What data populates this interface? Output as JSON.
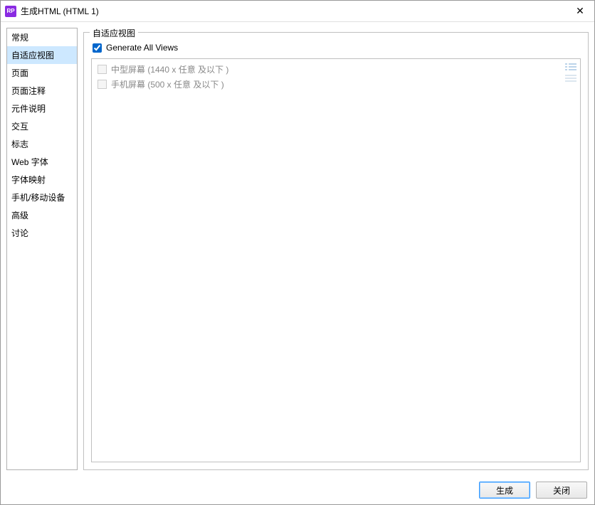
{
  "titlebar": {
    "icon_text": "RP",
    "title": "生成HTML (HTML 1)"
  },
  "sidebar": {
    "items": [
      {
        "label": "常规",
        "selected": false
      },
      {
        "label": "自适应视图",
        "selected": true
      },
      {
        "label": "页面",
        "selected": false
      },
      {
        "label": "页面注释",
        "selected": false
      },
      {
        "label": "元件说明",
        "selected": false
      },
      {
        "label": "交互",
        "selected": false
      },
      {
        "label": "标志",
        "selected": false
      },
      {
        "label": "Web 字体",
        "selected": false
      },
      {
        "label": "字体映射",
        "selected": false
      },
      {
        "label": "手机/移动设备",
        "selected": false
      },
      {
        "label": "高级",
        "selected": false
      },
      {
        "label": "讨论",
        "selected": false
      }
    ]
  },
  "panel": {
    "legend": "自适应视图",
    "generate_all_label": "Generate All Views",
    "generate_all_checked": true,
    "views": [
      {
        "label": "中型屏幕 (1440 x 任意  及以下 )"
      },
      {
        "label": "手机屏幕 (500 x 任意  及以下 )"
      }
    ]
  },
  "footer": {
    "generate": "生成",
    "close": "关闭"
  }
}
